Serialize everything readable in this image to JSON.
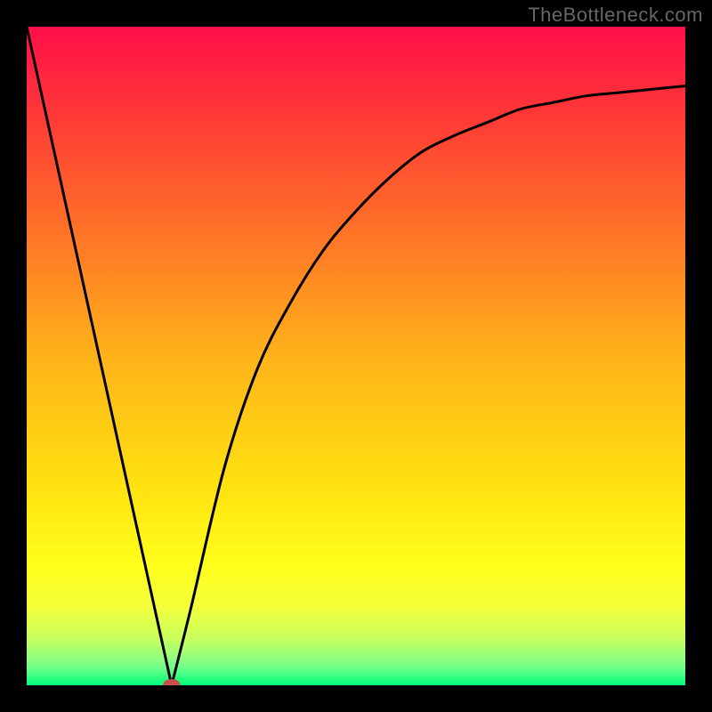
{
  "watermark": "TheBottleneck.com",
  "chart_data": {
    "type": "line",
    "title": "",
    "xlabel": "",
    "ylabel": "",
    "xlim": [
      0,
      100
    ],
    "ylim": [
      0,
      100
    ],
    "series": [
      {
        "name": "curve",
        "x": [
          0,
          5,
          10,
          15,
          20,
          22,
          25,
          30,
          35,
          40,
          45,
          50,
          55,
          60,
          65,
          70,
          75,
          80,
          85,
          90,
          95,
          100
        ],
        "values": [
          100,
          80,
          60,
          40,
          20,
          0,
          12,
          33,
          48,
          58,
          66,
          72,
          77,
          81,
          83.5,
          85.5,
          87.5,
          88.5,
          89.5,
          90,
          90.5,
          91
        ]
      }
    ],
    "marker": {
      "x": 22,
      "y": 0
    },
    "background_gradient": {
      "stops": [
        {
          "offset": 0.0,
          "color": "#ff0e4a"
        },
        {
          "offset": 0.13,
          "color": "#ff3737"
        },
        {
          "offset": 0.3,
          "color": "#ff6f28"
        },
        {
          "offset": 0.5,
          "color": "#ffb21a"
        },
        {
          "offset": 0.7,
          "color": "#ffe210"
        },
        {
          "offset": 0.82,
          "color": "#ffff1c"
        },
        {
          "offset": 0.88,
          "color": "#f4ff3a"
        },
        {
          "offset": 0.93,
          "color": "#c8ff60"
        },
        {
          "offset": 0.97,
          "color": "#7aff8a"
        },
        {
          "offset": 1.0,
          "color": "#00ff7a"
        }
      ]
    }
  }
}
